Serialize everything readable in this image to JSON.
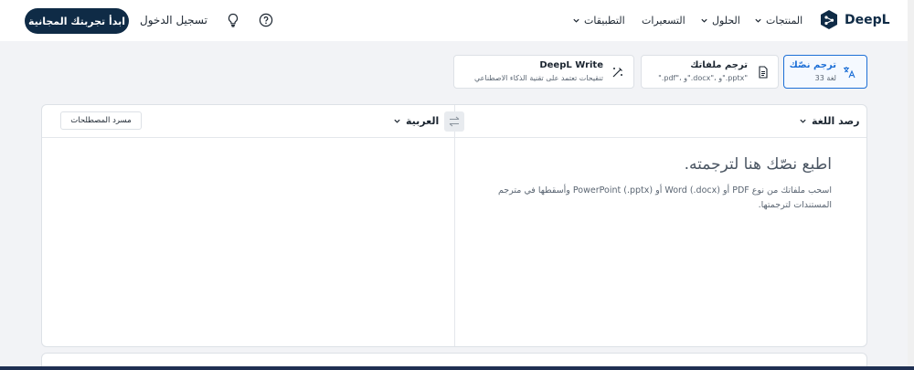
{
  "header": {
    "cta_label": "ابدأ تجربتك المجانية",
    "login_label": "تسجيل الدخول",
    "nav": {
      "apps": "التطبيقات",
      "pricing": "التسعيرات",
      "solutions": "الحلول",
      "products": "المنتجات"
    },
    "logo_text": "DeepL"
  },
  "modes": {
    "text": {
      "title": "ترجم نصّك",
      "subtitle": "33 لغة"
    },
    "files": {
      "title": "ترجم ملفاتك",
      "subtitle": "\".pdf\"، و\".docx\"، و\".pptx\""
    },
    "write": {
      "title": "DeepL Write",
      "subtitle": "تنقيحات تعتمد على تقنية الذكاء الاصطناعي"
    }
  },
  "translator": {
    "source_lang": "رصد اللغة",
    "target_lang": "العربية",
    "glossary_label": "مسرد المصطلحات",
    "placeholder_title": "اطبع نصّك هنا لترجمته.",
    "placeholder_sub": "اسحب ملفاتك من نوع PDF أو Word (.docx) أو PowerPoint (.pptx) وأسقطها في مترجم المستندات لترجمتها."
  },
  "icons": {
    "bulb": "lightbulb-icon",
    "help": "help-circle-icon",
    "translate": "translate-icon",
    "file": "file-icon",
    "write": "magic-wand-icon",
    "swap": "swap-icon"
  },
  "colors": {
    "brand": "#0f2b46",
    "accent": "#1d6fd6",
    "background": "#f2f3f6"
  }
}
